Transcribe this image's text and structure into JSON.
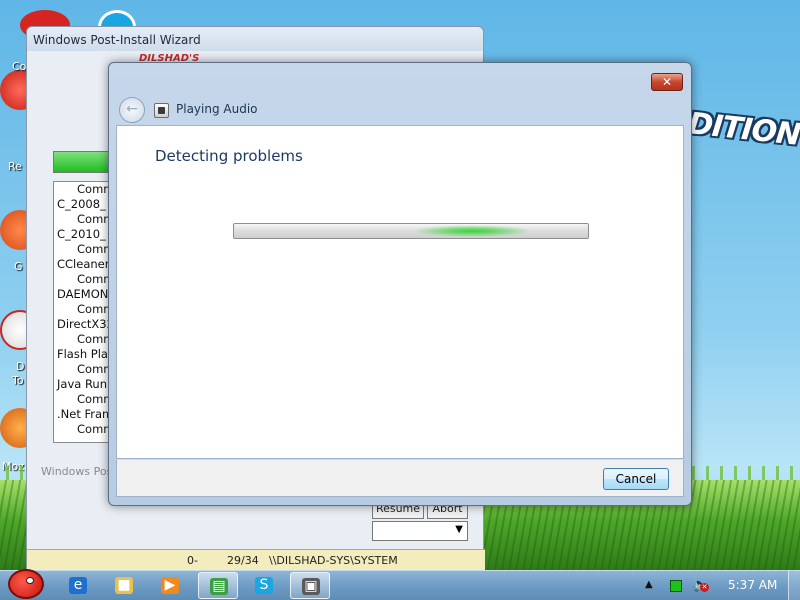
{
  "desktop": {
    "wallpaper_text": "DITION",
    "icon_labels": [
      "Co",
      "Re",
      "G",
      "D",
      "To",
      "Moz"
    ]
  },
  "background_window": {
    "title": "Windows Post-Install Wizard",
    "logo_text": "DILSHAD'S",
    "list_rows": [
      {
        "text": "Comm",
        "type": "indent"
      },
      {
        "text": "C_2008_",
        "type": "name"
      },
      {
        "text": "Comm",
        "type": "indent"
      },
      {
        "text": "C_2010_",
        "type": "name"
      },
      {
        "text": "Comm",
        "type": "indent"
      },
      {
        "text": "CCleaner",
        "type": "name"
      },
      {
        "text": "Comm",
        "type": "indent"
      },
      {
        "text": "DAEMON",
        "type": "name"
      },
      {
        "text": "Comm",
        "type": "indent"
      },
      {
        "text": "DirectX32",
        "type": "name"
      },
      {
        "text": "Comm",
        "type": "indent"
      },
      {
        "text": "Flash Pla",
        "type": "name"
      },
      {
        "text": "Comm",
        "type": "indent"
      },
      {
        "text": "Java Run",
        "type": "name"
      },
      {
        "text": "Comm",
        "type": "indent"
      },
      {
        "text": ".Net Fram",
        "type": "name"
      },
      {
        "text": "Comm",
        "type": "indent"
      }
    ],
    "footer_label": "Windows Post",
    "resume_button": "Resume",
    "abort_button": "Abort",
    "status_cells": [
      "0-",
      "29/34",
      "\\\\DILSHAD-SYS\\SYSTEM"
    ]
  },
  "dialog": {
    "header_title": "Playing Audio",
    "heading": "Detecting problems",
    "cancel_button": "Cancel",
    "close_glyph": "✕",
    "back_glyph": "←"
  },
  "taskbar": {
    "clock": "5:37 AM",
    "tray_up_glyph": "▲",
    "items": [
      {
        "name": "internet-explorer",
        "glyph": "e",
        "color": "#1f6fd1",
        "active": false
      },
      {
        "name": "folder",
        "glyph": "■",
        "color": "#e8c24a",
        "active": false
      },
      {
        "name": "media-player",
        "glyph": "▶",
        "color": "#f08a1e",
        "active": false
      },
      {
        "name": "wizard",
        "glyph": "▤",
        "color": "#3aa043",
        "active": true
      },
      {
        "name": "skype",
        "glyph": "S",
        "color": "#1aa5e3",
        "active": false
      },
      {
        "name": "troubleshooter",
        "glyph": "▣",
        "color": "#5a5a5a",
        "active": true
      }
    ]
  }
}
